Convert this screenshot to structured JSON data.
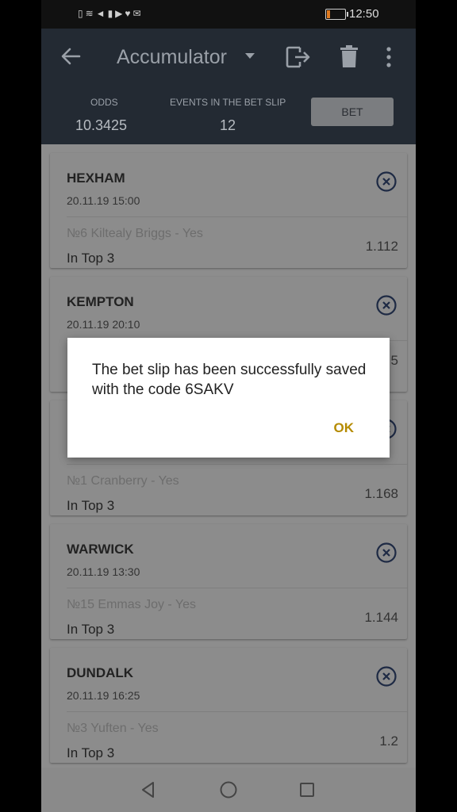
{
  "status_bar": {
    "time": "12:50",
    "battery_level": 0.2,
    "icons": [
      "sim-card-icon",
      "wifi-icon",
      "location-icon",
      "battery-saver-icon",
      "play-icon",
      "twitter-icon",
      "mail-icon"
    ]
  },
  "header": {
    "title": "Accumulator",
    "odds_label": "ODDS",
    "odds_value": "10.3425",
    "events_label": "EVENTS IN THE BET SLIP",
    "events_value": "12",
    "bet_label": "BET"
  },
  "cards": [
    {
      "track": "HEXHAM",
      "date": "20.11.19 15:00",
      "runner": "№6 Kiltealy Briggs - Yes",
      "market": "In Top 3",
      "odds": "1.112"
    },
    {
      "track": "KEMPTON",
      "date": "20.11.19 20:10",
      "runner": "",
      "market": "",
      "odds": "5"
    },
    {
      "track": "",
      "date": "",
      "runner": "№1 Cranberry - Yes",
      "market": "In Top 3",
      "odds": "1.168"
    },
    {
      "track": "WARWICK",
      "date": "20.11.19 13:30",
      "runner": "№15 Emmas Joy - Yes",
      "market": "In Top 3",
      "odds": "1.144"
    },
    {
      "track": "DUNDALK",
      "date": "20.11.19 16:25",
      "runner": "№3 Yuften - Yes",
      "market": "In Top 3",
      "odds": "1.2"
    }
  ],
  "dialog": {
    "message": "The bet slip has been successfully saved with the code 6SAKV",
    "ok_label": "OK"
  },
  "colors": {
    "header_bg": "#232a33",
    "accent_icon": "#1e2a44",
    "dialog_ok": "#b58b00"
  }
}
